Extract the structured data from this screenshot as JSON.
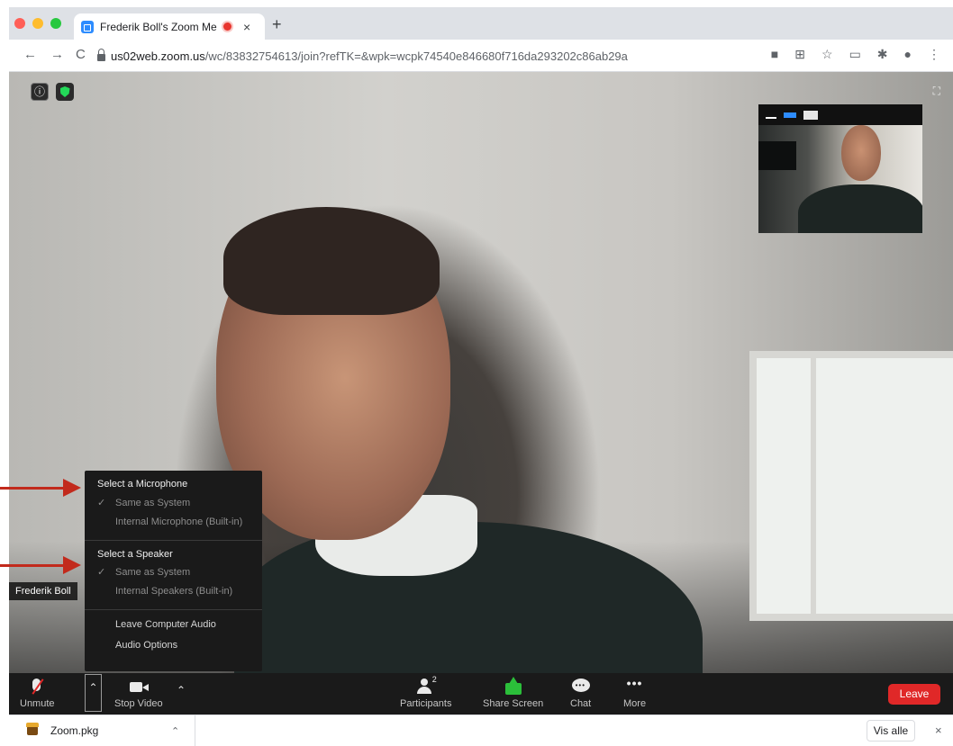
{
  "browser": {
    "tab_title": "Frederik Boll's Zoom Meeti",
    "tab_close": "×",
    "new_tab": "+",
    "nav_back": "←",
    "nav_forward": "→",
    "nav_reload": "C",
    "url_host": "us02web.zoom.us",
    "url_path": "/wc/83832754613/join?refTK=&wpk=wcpk74540e846680f716da293202c86ab29a"
  },
  "meeting": {
    "info_icon": "ⓘ",
    "participant_name": "Frederik Boll"
  },
  "audio_menu": {
    "mic_header": "Select a Microphone",
    "mic_options": [
      {
        "label": "Same as System",
        "checked": true
      },
      {
        "label": "Internal Microphone (Built-in)",
        "checked": false
      }
    ],
    "speaker_header": "Select a Speaker",
    "speaker_options": [
      {
        "label": "Same as System",
        "checked": true
      },
      {
        "label": "Internal Speakers (Built-in)",
        "checked": false
      }
    ],
    "leave_audio": "Leave Computer Audio",
    "audio_options": "Audio Options"
  },
  "controls": {
    "unmute": "Unmute",
    "stop_video": "Stop Video",
    "participants": "Participants",
    "participants_count": "2",
    "share_screen": "Share Screen",
    "chat": "Chat",
    "more": "More",
    "leave": "Leave"
  },
  "downloads": {
    "file_name": "Zoom.pkg",
    "show_all": "Vis alle",
    "close": "×"
  },
  "colors": {
    "leave_red": "#e02828",
    "share_green": "#2bbf3a",
    "zoom_blue": "#2d8cff",
    "annotation_arrow": "#c22a1c"
  }
}
